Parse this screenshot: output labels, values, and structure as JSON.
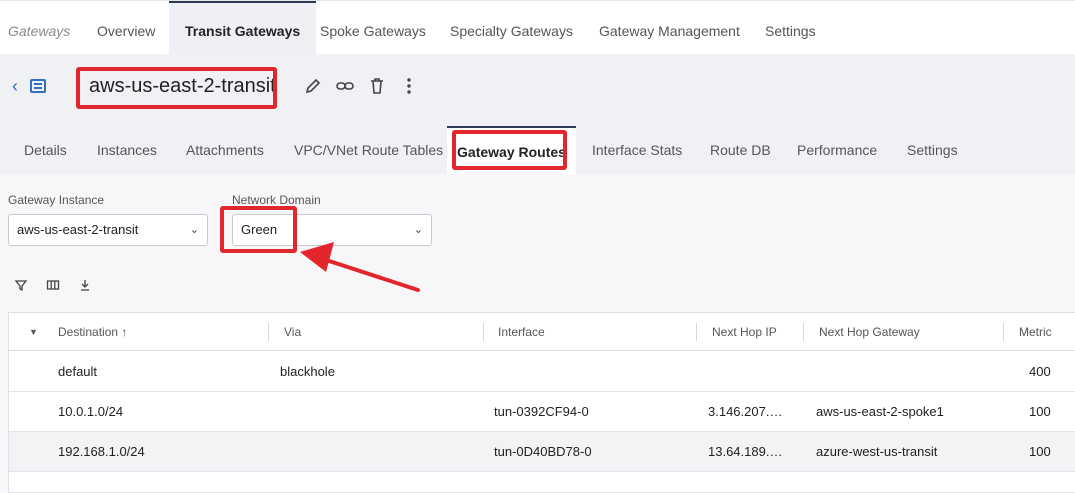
{
  "topnav": {
    "brand": "Gateways",
    "items": [
      "Overview",
      "Transit Gateways",
      "Spoke Gateways",
      "Specialty Gateways",
      "Gateway Management",
      "Settings"
    ]
  },
  "header": {
    "title": "aws-us-east-2-transit",
    "icons": [
      "back-chevron-icon",
      "list-icon",
      "edit-pencil-icon",
      "link-icon",
      "trash-icon",
      "more-vertical-icon"
    ]
  },
  "subtabs": [
    "Details",
    "Instances",
    "Attachments",
    "VPC/VNet Route Tables",
    "Gateway Routes",
    "Interface Stats",
    "Route DB",
    "Performance",
    "Settings"
  ],
  "filters": {
    "gateway_instance_label": "Gateway Instance",
    "gateway_instance_value": "aws-us-east-2-transit",
    "network_domain_label": "Network Domain",
    "network_domain_value": "Green"
  },
  "toolbar_icons": [
    "filter-icon",
    "columns-icon",
    "download-icon"
  ],
  "table": {
    "columns": [
      "Destination",
      "Via",
      "Interface",
      "Next Hop IP",
      "Next Hop Gateway",
      "Metric"
    ],
    "rows": [
      [
        "default",
        "blackhole",
        "",
        "",
        "",
        "400"
      ],
      [
        "10.0.1.0/24",
        "",
        "tun-0392CF94-0",
        "3.146.207.…",
        "aws-us-east-2-spoke1",
        "100"
      ],
      [
        "192.168.1.0/24",
        "",
        "tun-0D40BD78-0",
        "13.64.189.…",
        "azure-west-us-transit",
        "100"
      ]
    ]
  },
  "colors": {
    "highlight": "#e3262c",
    "accent": "#3070c8",
    "nav_active_border": "#2d3a55"
  }
}
